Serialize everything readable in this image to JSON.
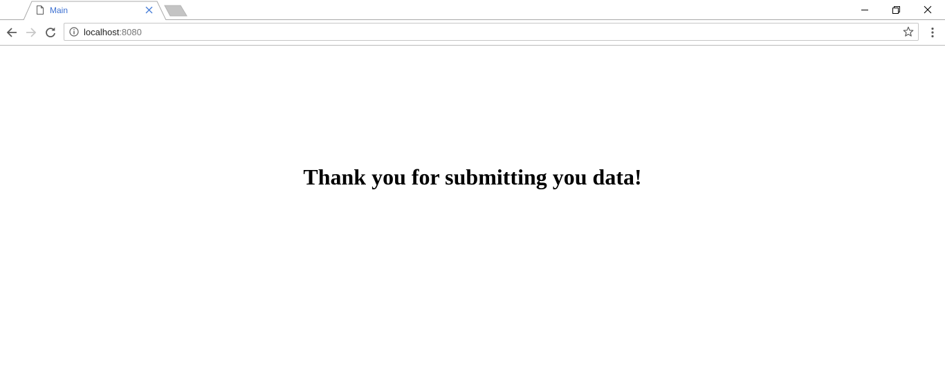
{
  "browser": {
    "tab": {
      "title": "Main"
    },
    "address_bar": {
      "host": "localhost",
      "port": ":8080"
    }
  },
  "page": {
    "heading": "Thank you for submitting you data!"
  },
  "colors": {
    "tab_title": "#3b6fd1",
    "heading": "#000000",
    "background": "#ffffff"
  },
  "icons": {
    "favicon": "page-icon",
    "tab_close": "close-icon",
    "new_tab": "new-tab-icon",
    "minimize": "minimize-icon",
    "restore": "restore-icon",
    "window_close": "close-icon",
    "back": "arrow-left-icon",
    "forward": "arrow-right-icon",
    "reload": "reload-icon",
    "site_info": "info-icon",
    "bookmark": "star-icon",
    "menu": "vertical-dots-icon"
  }
}
